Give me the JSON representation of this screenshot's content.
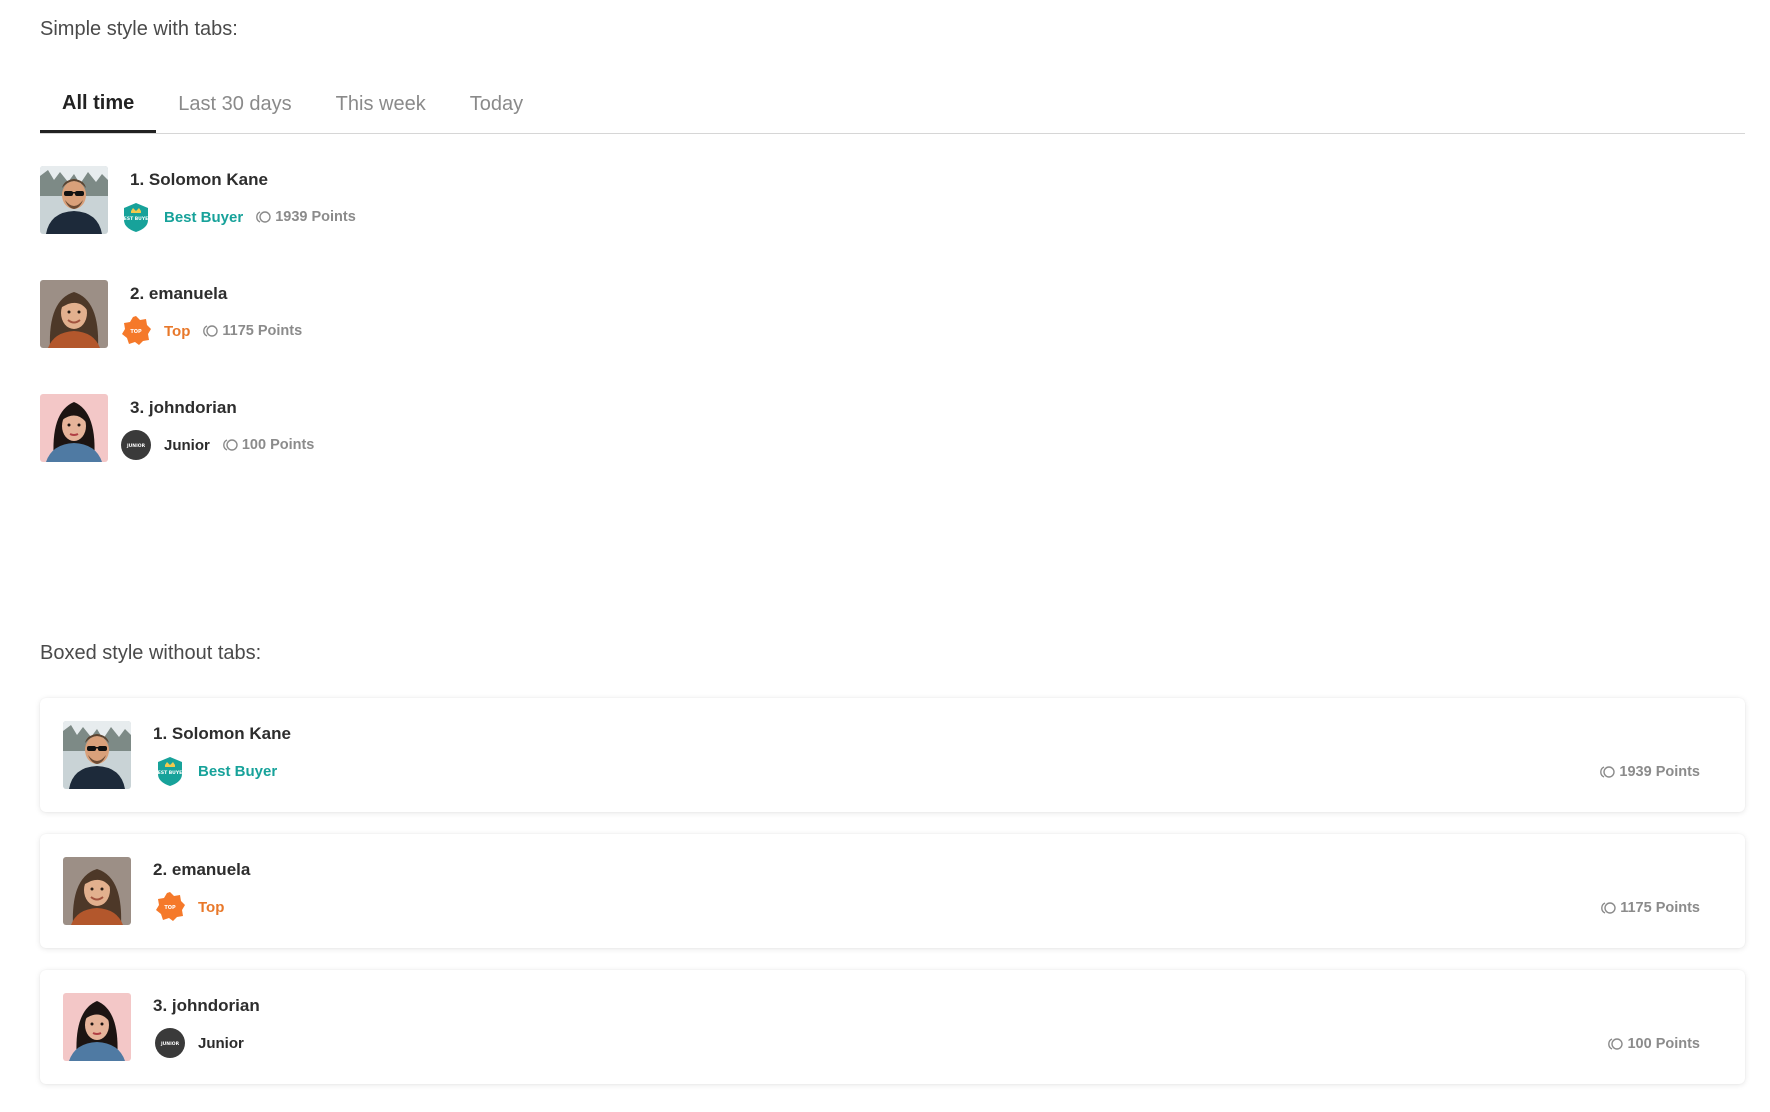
{
  "simple_section": {
    "title": "Simple style with tabs:",
    "tabs": [
      {
        "label": "All time",
        "active": true
      },
      {
        "label": "Last 30 days",
        "active": false
      },
      {
        "label": "This week",
        "active": false
      },
      {
        "label": "Today",
        "active": false
      }
    ],
    "rows": [
      {
        "name": "1. Solomon Kane",
        "rank": "Best Buyer",
        "rank_color": "#17a29a",
        "points": "1939 Points",
        "badge": "best-buyer-badge"
      },
      {
        "name": "2. emanuela",
        "rank": "Top",
        "rank_color": "#e8782a",
        "points": "1175 Points",
        "badge": "top-badge"
      },
      {
        "name": "3. johndorian",
        "rank": "Junior",
        "rank_color": "#2b2b2b",
        "points": "100 Points",
        "badge": "junior-badge"
      }
    ]
  },
  "boxed_section": {
    "title": "Boxed style without tabs:",
    "rows": [
      {
        "name": "1. Solomon Kane",
        "rank": "Best Buyer",
        "rank_color": "#17a29a",
        "points": "1939 Points",
        "badge": "best-buyer-badge"
      },
      {
        "name": "2. emanuela",
        "rank": "Top",
        "rank_color": "#e8782a",
        "points": "1175 Points",
        "badge": "top-badge"
      },
      {
        "name": "3. johndorian",
        "rank": "Junior",
        "rank_color": "#2b2b2b",
        "points": "100 Points",
        "badge": "junior-badge"
      }
    ]
  },
  "badges": {
    "best_buyer_text": "BEST BUYER",
    "top_text": "TOP",
    "junior_text": "JUNIOR"
  },
  "colors": {
    "best_buyer": "#17a29a",
    "top": "#f5792a",
    "junior": "#3a3a3a",
    "points": "#8b8b8b"
  }
}
